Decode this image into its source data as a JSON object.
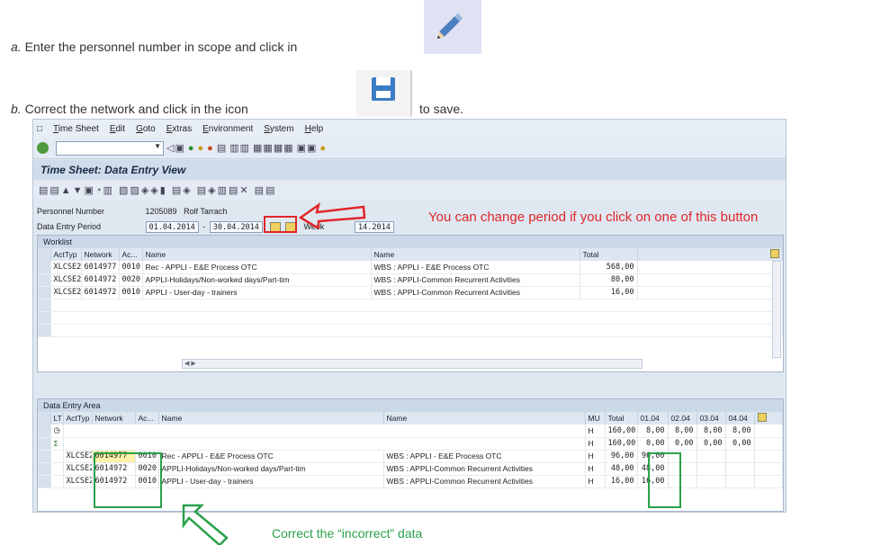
{
  "instructions": {
    "a_letter": "a.",
    "a_text": "Enter the personnel number in scope and click in",
    "b_letter": "b.",
    "b_text_1": "Correct the network and click in the icon",
    "b_text_2": "to save."
  },
  "menu": [
    "Time Sheet",
    "Edit",
    "Goto",
    "Extras",
    "Environment",
    "System",
    "Help"
  ],
  "title": "Time Sheet: Data Entry View",
  "fields": {
    "personnel_label": "Personnel Number",
    "personnel_value": "1205089",
    "personnel_name": "Rolf Tarrach",
    "period_label": "Data Entry Period",
    "period_from": "01.04.2014",
    "period_dash": "-",
    "period_to": "30.04.2014",
    "week_label": "Week",
    "week_value": "14.2014"
  },
  "worklist": {
    "title": "Worklist",
    "headers": [
      "ActTyp",
      "Network",
      "Ac...",
      "Name",
      "Name",
      "Total"
    ],
    "rows": [
      [
        "XLCSE2",
        "6014977",
        "0010",
        "Rec - APPLI - E&E Process OTC",
        "WBS : APPLI - E&E Process OTC",
        "568,00"
      ],
      [
        "XLCSE2",
        "6014972",
        "0020",
        "APPLI-Holidays/Non-worked days/Part-tim",
        "WBS : APPLI-Common Recurrent Activities",
        "80,00"
      ],
      [
        "XLCSE2",
        "6014972",
        "0010",
        "APPLI - User-day - trainers",
        "WBS : APPLI-Common Recurrent Activities",
        "16,00"
      ]
    ]
  },
  "entry": {
    "title": "Data Entry Area",
    "headers": [
      "LT",
      "ActTyp",
      "Network",
      "Ac...",
      "Name",
      "Name",
      "MU",
      "Total",
      "01.04",
      "02.04",
      "03.04",
      "04.04"
    ],
    "sum1": {
      "mu": "H",
      "total": "160,00",
      "d1": "8,00",
      "d2": "8,00",
      "d3": "8,00",
      "d4": "8,00"
    },
    "sum2": {
      "mu": "H",
      "total": "160,00",
      "d1": "0,00",
      "d2": "0,00",
      "d3": "0,00",
      "d4": "0,00"
    },
    "rows": [
      [
        "XLCSE2",
        "6014977",
        "0010",
        "Rec - APPLI - E&E Process OTC",
        "WBS : APPLI - E&E Process OTC",
        "H",
        "96,00",
        "96,00"
      ],
      [
        "XLCSE2",
        "6014972",
        "0020",
        "APPLI-Holidays/Non-worked days/Part-tim",
        "WBS : APPLI-Common Recurrent Activities",
        "H",
        "48,00",
        "48,00"
      ],
      [
        "XLCSE2",
        "6014972",
        "0010",
        "APPLI - User-day - trainers",
        "WBS : APPLI-Common Recurrent Activities",
        "H",
        "16,00",
        "16,00"
      ]
    ]
  },
  "annotations": {
    "red": "You can change period if you click on one of this button",
    "green": "Correct the “incorrect” data"
  },
  "colors": {
    "red": "#e0262a",
    "green": "#2aa14a"
  }
}
